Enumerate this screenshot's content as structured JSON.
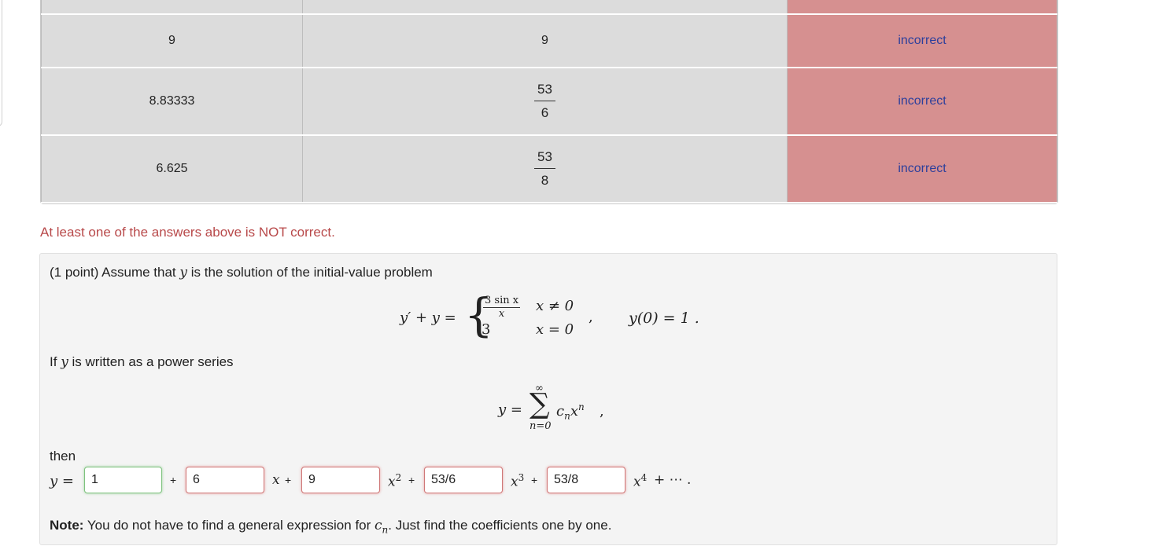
{
  "results_table": {
    "rows": [
      {
        "entered": "",
        "preview": "",
        "status": ""
      },
      {
        "entered": "9",
        "preview": "9",
        "status": "incorrect"
      },
      {
        "entered": "8.83333",
        "preview_num": "53",
        "preview_den": "6",
        "status": "incorrect"
      },
      {
        "entered": "6.625",
        "preview_num": "53",
        "preview_den": "8",
        "status": "incorrect"
      }
    ]
  },
  "warning_text": "At least one of the answers above is NOT correct.",
  "problem": {
    "intro_prefix": "(1 point) Assume that",
    "intro_var": "y",
    "intro_suffix": "is the solution of the initial-value problem",
    "eq1": {
      "lhs": "y′ + y =",
      "case1_num": "3 sin x",
      "case1_den": "x",
      "case1_cond": "x ≠ 0",
      "case2_val": "3",
      "case2_cond": "x = 0",
      "comma": ",",
      "initial": "y(0) = 1 ."
    },
    "series_prefix": "If",
    "series_var": "y",
    "series_suffix": "is written as a power series",
    "eq2": {
      "lhs": "y =",
      "upper": "∞",
      "sigma": "∑",
      "lower": "n=0",
      "term_c": "c",
      "term_sub": "n",
      "term_x": "x",
      "term_sup": "n",
      "comma": ","
    },
    "then_label": "then",
    "answer_row": {
      "lhs": "y =",
      "inputs": [
        "1",
        "6",
        "9",
        "53/6",
        "53/8"
      ],
      "plus": "+",
      "x1": "x",
      "x2": "x",
      "x2_exp": "2",
      "x3": "x",
      "x3_exp": "3",
      "x4": "x",
      "x4_exp": "4",
      "tail": "+ ⋯ ."
    },
    "note_bold": "Note:",
    "note_prefix": "You do not have to find a general expression for",
    "note_c": "c",
    "note_sub": "n",
    "note_suffix": ". Just find the coefficients one by one."
  },
  "colors": {
    "incorrect_bg": "#d69090",
    "incorrect_text": "#2c3f9c",
    "warning": "#b8494a",
    "input_wrong": "#cf7777",
    "input_right": "#7ec27e"
  }
}
